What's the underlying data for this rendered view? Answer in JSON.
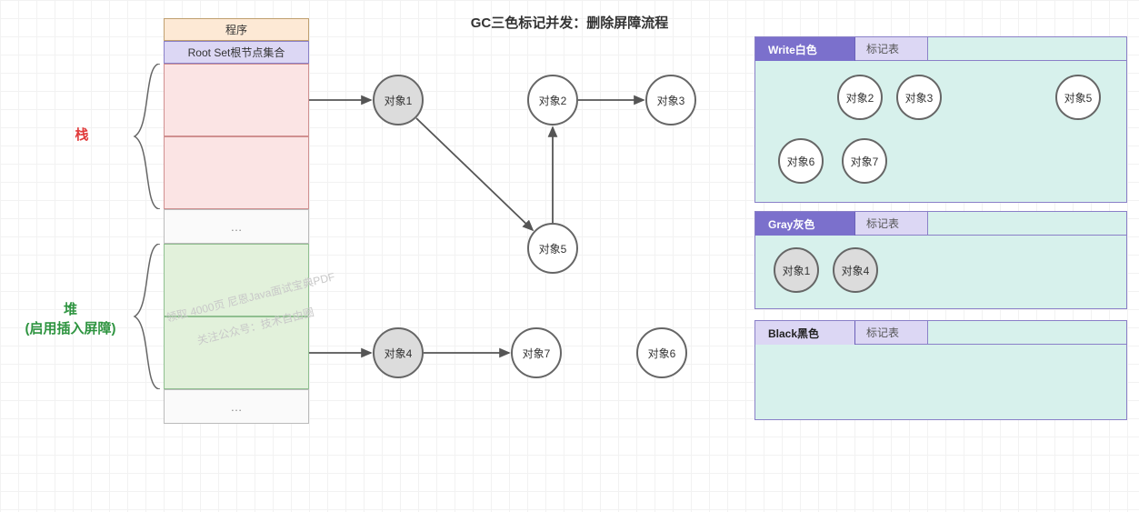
{
  "title": "GC三色标记并发：删除屏障流程",
  "column": {
    "program": "程序",
    "rootset": "Root Set根节点集合",
    "ellipsis": "…"
  },
  "sideLabels": {
    "stack": "栈",
    "heap_line1": "堆",
    "heap_line2": "(启用插入屏障)"
  },
  "objects": {
    "o1": "对象1",
    "o2": "对象2",
    "o3": "对象3",
    "o4": "对象4",
    "o5": "对象5",
    "o6": "对象6",
    "o7": "对象7"
  },
  "panels": {
    "white": {
      "title": "Write白色",
      "sub": "标记表"
    },
    "gray": {
      "title": "Gray灰色",
      "sub": "标记表"
    },
    "black": {
      "title": "Black黑色",
      "sub": "标记表"
    }
  },
  "watermark": {
    "line1": "领取 4000页 尼恩Java面试宝典PDF",
    "line2": "关注公众号：技术自由圈"
  }
}
